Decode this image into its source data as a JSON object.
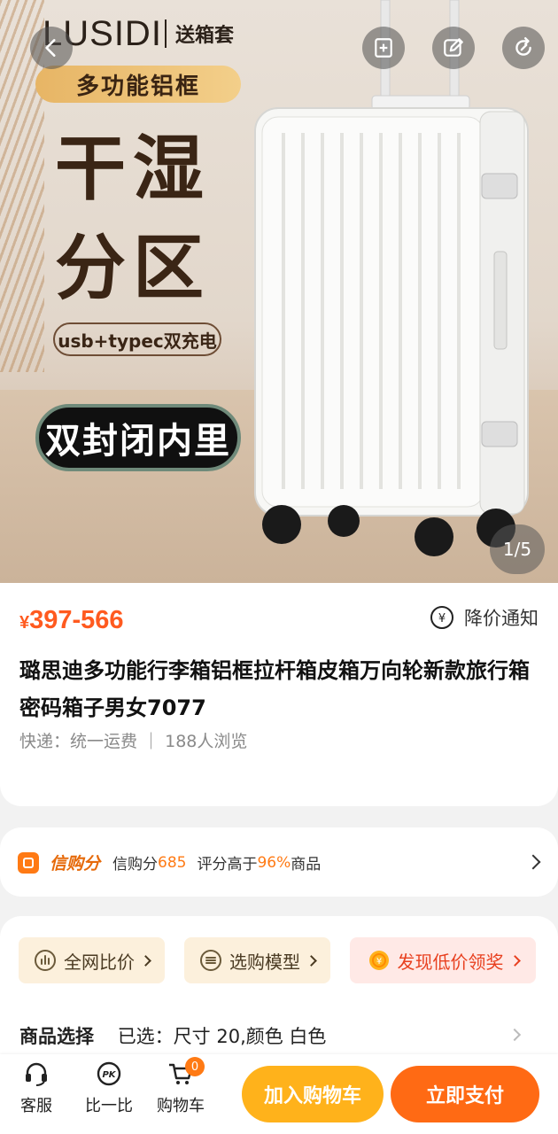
{
  "hero": {
    "brand": "LUSIDI",
    "brand_sub": "送箱套",
    "tag_gold": "多功能铝框",
    "headline_1": "干湿",
    "headline_2": "分区",
    "tag_outline": "usb+typec双充电",
    "tag_black": "双封闭内里",
    "counter": "1/5"
  },
  "header_icons": [
    "back-icon",
    "add-bookmark-icon",
    "edit-icon",
    "share-icon"
  ],
  "product": {
    "price_symbol": "¥",
    "price_range": "397-566",
    "price_alert": "降价通知",
    "title": "璐思迪多功能行李箱铝框拉杆箱皮箱万向轮新款旅行箱密码箱子男女7077",
    "shipping": "快递：统一运费",
    "views": "188人浏览"
  },
  "credit": {
    "name": "信购分",
    "score_label": "信购分",
    "score": "685",
    "compare_text": "评分高于",
    "percent": "96%",
    "suffix": "商品"
  },
  "options": {
    "compare_price": "全网比价",
    "model_guide": "选购模型",
    "low_price_reward": "发现低价领奖"
  },
  "selection": {
    "label": "商品选择",
    "value": "已选：尺寸 20,颜色 白色"
  },
  "bottom_bar": {
    "service": "客服",
    "compare": "比一比",
    "cart": "购物车",
    "cart_count": "0",
    "add_to_cart": "加入购物车",
    "buy_now": "立即支付"
  },
  "colors": {
    "accent_orange": "#ff6a14",
    "accent_yellow": "#ffb21b",
    "price": "#ff5a1f"
  }
}
